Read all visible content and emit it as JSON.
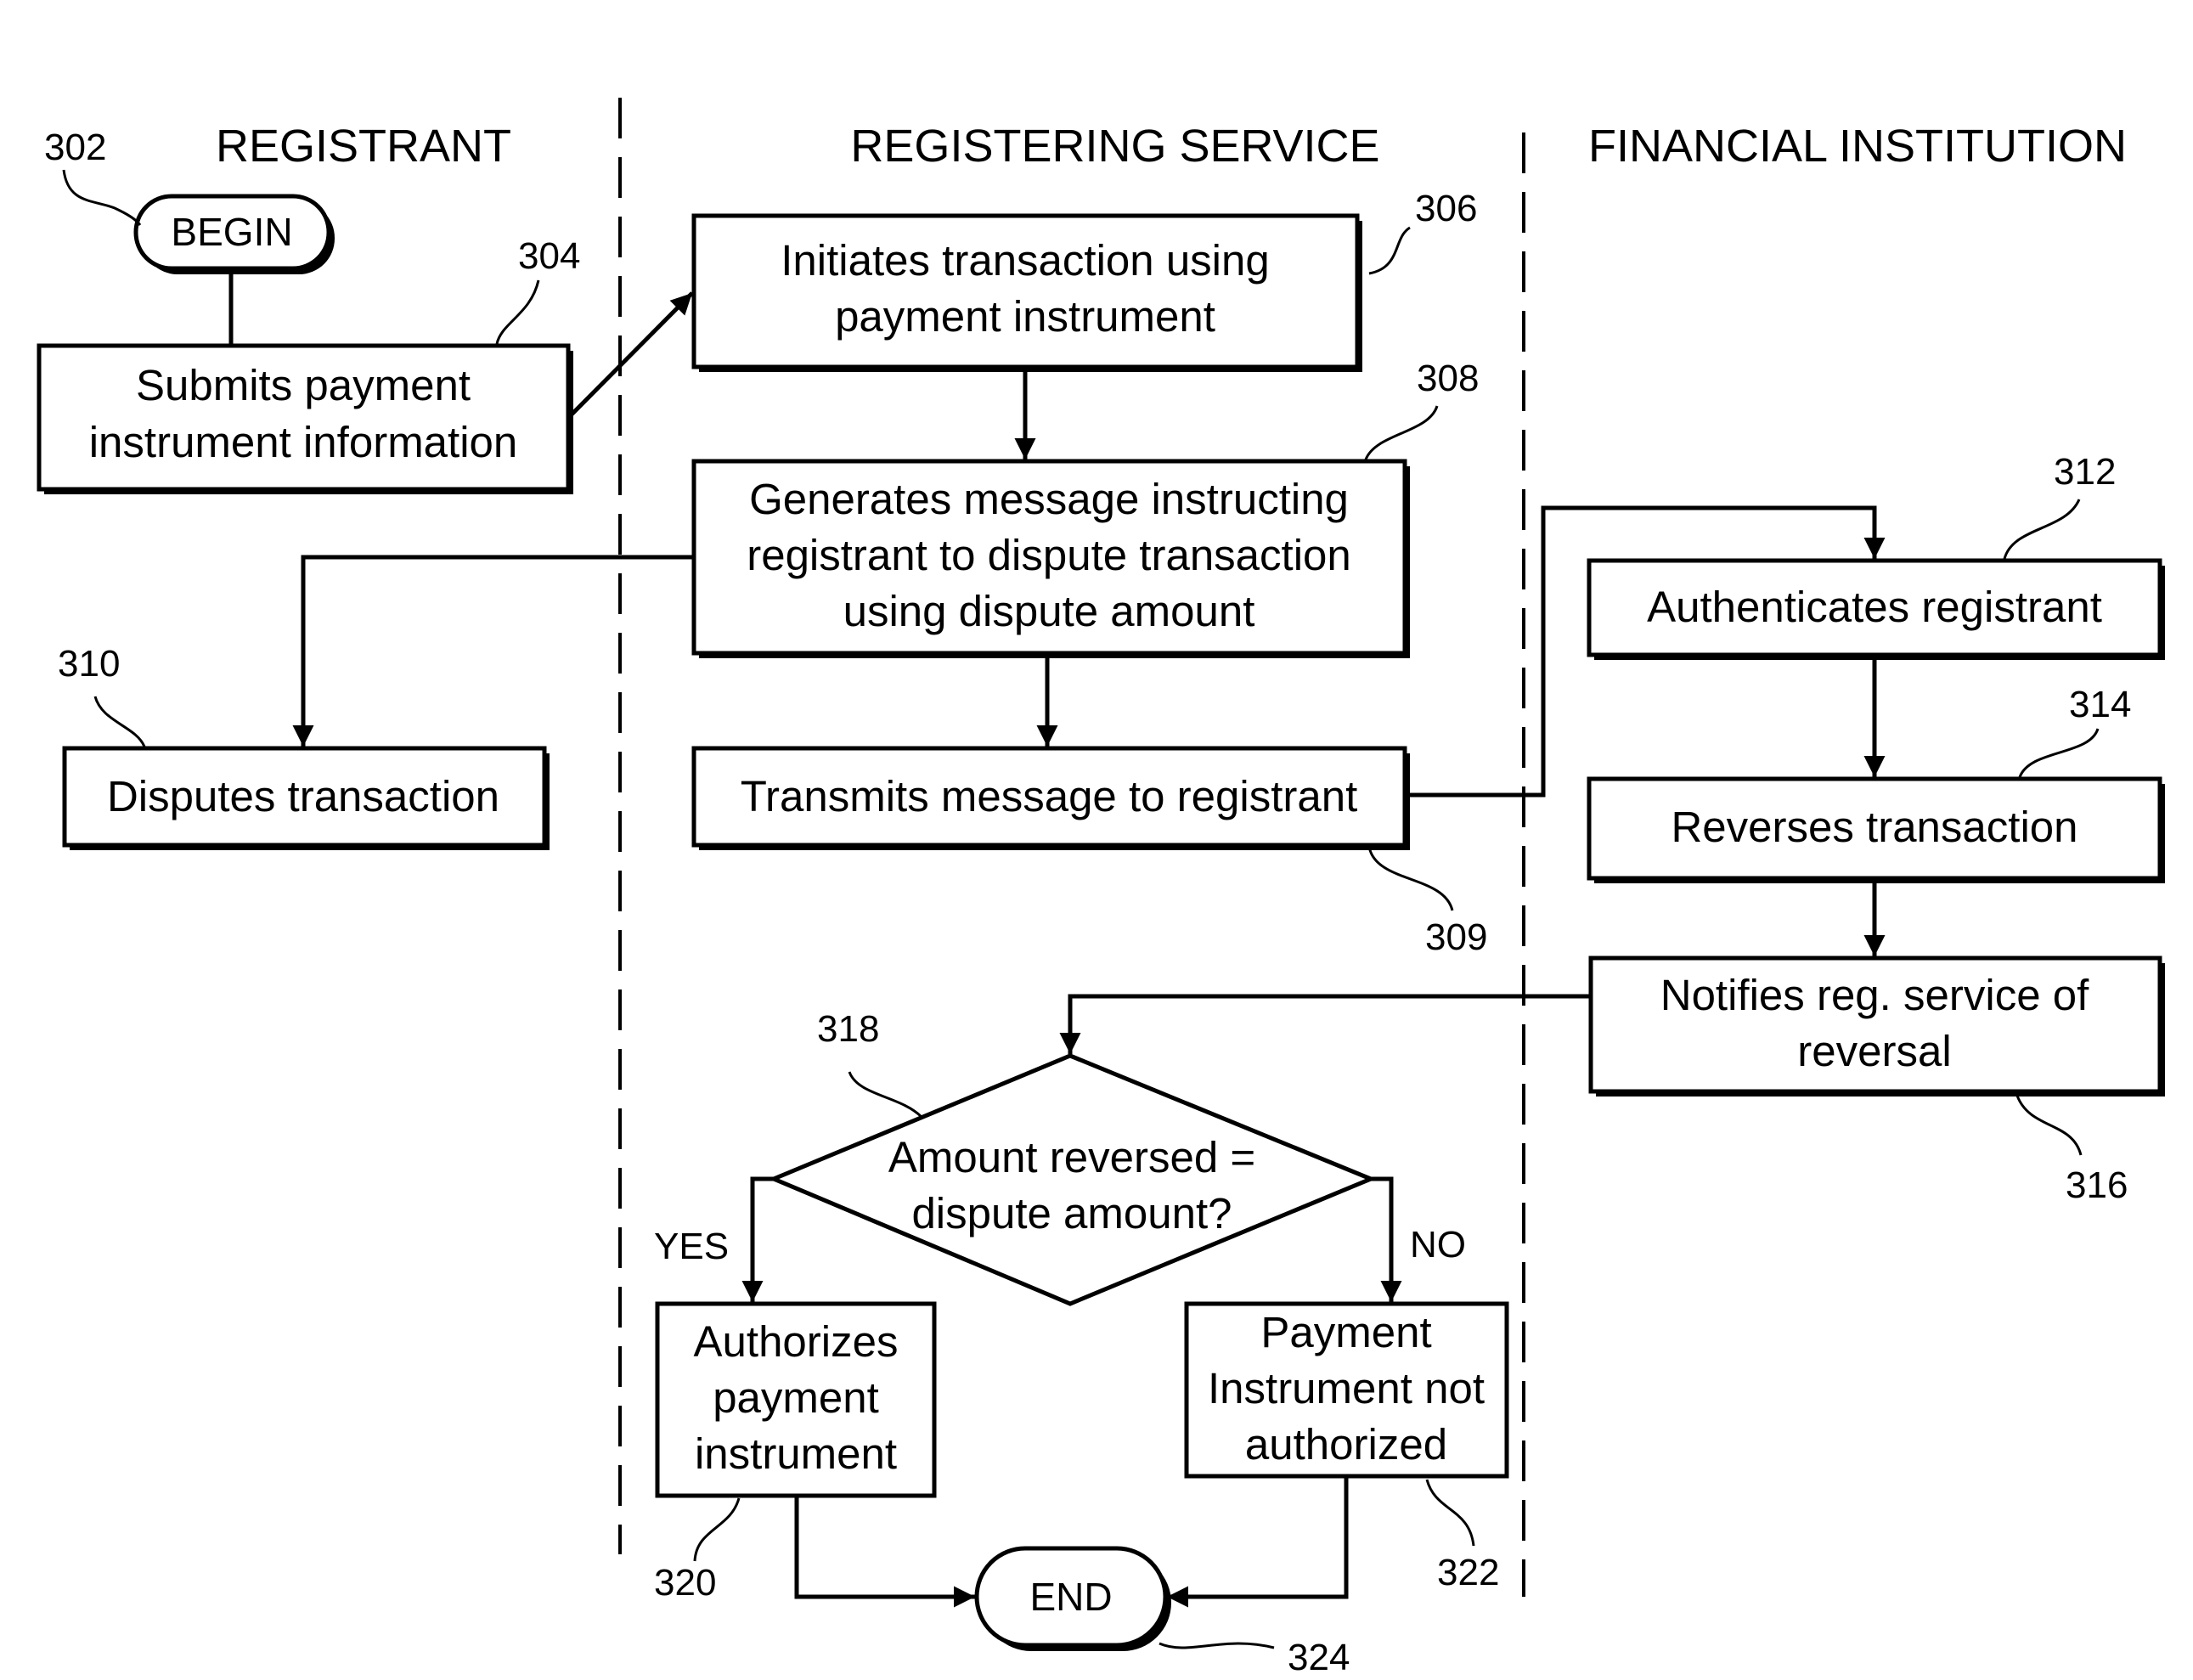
{
  "lanes": {
    "registrant": "REGISTRANT",
    "registering_service": "REGISTERING SERVICE",
    "financial_institution": "FINANCIAL INSTITUTION"
  },
  "nodes": {
    "n302": {
      "ref": "302",
      "type": "terminal",
      "lines": [
        "BEGIN"
      ]
    },
    "n304": {
      "ref": "304",
      "type": "process",
      "lines": [
        "Submits payment",
        "instrument information"
      ]
    },
    "n306": {
      "ref": "306",
      "type": "process",
      "lines": [
        "Initiates transaction using",
        "payment instrument"
      ]
    },
    "n308": {
      "ref": "308",
      "type": "process",
      "lines": [
        "Generates message instructing",
        "registrant to dispute transaction",
        "using dispute amount"
      ]
    },
    "n309": {
      "ref": "309",
      "type": "process",
      "lines": [
        "Transmits message to registrant"
      ]
    },
    "n310": {
      "ref": "310",
      "type": "process",
      "lines": [
        "Disputes transaction"
      ]
    },
    "n312": {
      "ref": "312",
      "type": "process",
      "lines": [
        "Authenticates registrant"
      ]
    },
    "n314": {
      "ref": "314",
      "type": "process",
      "lines": [
        "Reverses transaction"
      ]
    },
    "n316": {
      "ref": "316",
      "type": "process",
      "lines": [
        "Notifies reg. service of",
        "reversal"
      ]
    },
    "n318": {
      "ref": "318",
      "type": "decision",
      "lines": [
        "Amount reversed =",
        "dispute amount?"
      ]
    },
    "n320": {
      "ref": "320",
      "type": "process",
      "lines": [
        "Authorizes",
        "payment",
        "instrument"
      ]
    },
    "n322": {
      "ref": "322",
      "type": "process",
      "lines": [
        "Payment",
        "Instrument not",
        "authorized"
      ]
    },
    "n324": {
      "ref": "324",
      "type": "terminal",
      "lines": [
        "END"
      ]
    }
  },
  "branches": {
    "yes": "YES",
    "no": "NO"
  },
  "edges": [
    {
      "from": "302",
      "to": "304"
    },
    {
      "from": "304",
      "to": "306"
    },
    {
      "from": "306",
      "to": "308"
    },
    {
      "from": "308",
      "to": "310"
    },
    {
      "from": "308",
      "to": "309"
    },
    {
      "from": "309",
      "to": "312"
    },
    {
      "from": "312",
      "to": "314"
    },
    {
      "from": "314",
      "to": "316"
    },
    {
      "from": "316",
      "to": "318"
    },
    {
      "from": "318",
      "to": "320",
      "label": "YES"
    },
    {
      "from": "318",
      "to": "322",
      "label": "NO"
    },
    {
      "from": "320",
      "to": "324"
    },
    {
      "from": "322",
      "to": "324"
    }
  ]
}
